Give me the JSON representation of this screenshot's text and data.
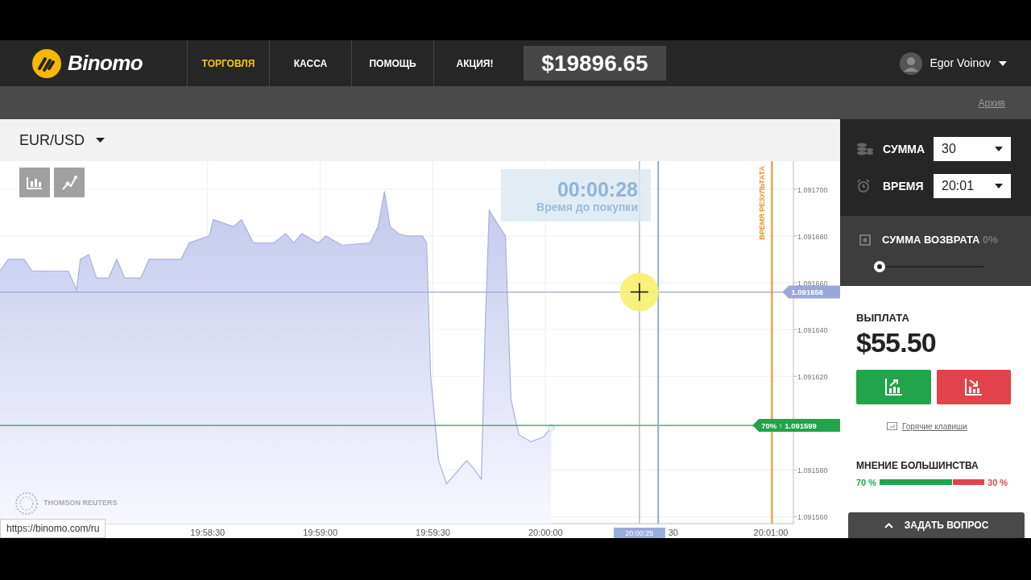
{
  "header": {
    "logo": "Binomo",
    "nav": [
      {
        "label": "ТОРГОВЛЯ",
        "selected": true
      },
      {
        "label": "КАССА",
        "selected": false
      },
      {
        "label": "ПОМОЩЬ",
        "selected": false
      },
      {
        "label": "АКЦИЯ!",
        "selected": false
      }
    ],
    "balance": "$19896.65",
    "user": {
      "name": "Egor Voinov"
    }
  },
  "subbar": {
    "archive_link": "Архив"
  },
  "chart_panel": {
    "pair": "EUR/USD",
    "timer": {
      "time": "00:00:28",
      "label": "Время до покупки"
    },
    "source": "THOMSON REUTERS",
    "clipped_time_label": "30",
    "crosshair_time": "20:00:25",
    "chart_data": {
      "type": "area",
      "grid": true,
      "xlim": [
        71854.7,
        72066
      ],
      "ylim": [
        1.091557,
        1.091712
      ],
      "xticks": [
        {
          "value": 71910,
          "label": "19:58:30"
        },
        {
          "value": 71940,
          "label": "19:59:00"
        },
        {
          "value": 71970,
          "label": "19:59:30"
        },
        {
          "value": 72000,
          "label": "20:00:00"
        },
        {
          "value": 72060,
          "label": "20:01:00"
        }
      ],
      "yticks": [
        {
          "value": 1.0917,
          "label": "1.091700"
        },
        {
          "value": 1.09168,
          "label": "1.091680"
        },
        {
          "value": 1.09166,
          "label": "1.091660"
        },
        {
          "value": 1.09164,
          "label": "1.091640"
        },
        {
          "value": 1.09162,
          "label": "1.091620"
        },
        {
          "value": 1.09158,
          "label": "1.091580"
        },
        {
          "value": 1.09156,
          "label": "1.091560"
        }
      ],
      "x": [
        71854.7,
        71856.9,
        71861.1,
        71863.3,
        71872.9,
        71875.1,
        71876.1,
        71878.3,
        71880.4,
        71883.6,
        71885.8,
        71887.9,
        71892.2,
        71894.4,
        71902.9,
        71905.1,
        71910.4,
        71911.5,
        71916.9,
        71919,
        71922.2,
        71927.6,
        71930.8,
        71932.9,
        71935.1,
        71939.4,
        71941.5,
        71945.8,
        71953.3,
        71955.4,
        71957.1,
        71958.6,
        71960.8,
        71962.9,
        71967.2,
        71968.3,
        71969.4,
        71971.5,
        71973.6,
        71975.8,
        71979,
        71981.1,
        71982.9,
        71983.9,
        71985,
        71986.5,
        71989.3,
        71990.8,
        71992.9,
        71996.1,
        71999.4,
        72001.5
      ],
      "series": [
        {
          "color": "#a9b0dd",
          "values": [
            1.091665,
            1.09167,
            1.09167,
            1.091665,
            1.091665,
            1.091657,
            1.09167,
            1.091672,
            1.091662,
            1.091662,
            1.09167,
            1.091662,
            1.091662,
            1.09167,
            1.09167,
            1.091677,
            1.09168,
            1.091687,
            1.091684,
            1.091687,
            1.091677,
            1.091677,
            1.091681,
            1.091677,
            1.091681,
            1.091677,
            1.09168,
            1.091676,
            1.091677,
            1.091684,
            1.091699,
            1.091684,
            1.091681,
            1.09168,
            1.09168,
            1.091677,
            1.09162,
            1.091584,
            1.091574,
            1.091578,
            1.091584,
            1.09158,
            1.091576,
            1.09164,
            1.091691,
            1.091687,
            1.09168,
            1.09161,
            1.091595,
            1.091592,
            1.091594,
            1.091598
          ]
        }
      ],
      "ref_lines": [
        {
          "axis": "y",
          "value": 1.091656,
          "label": "1.091656",
          "color": "#9aa7d9"
        },
        {
          "axis": "y",
          "value": 1.091599,
          "label": "70% ↑ 1.091599",
          "color": "#22a44b"
        },
        {
          "axis": "x",
          "value": 72025,
          "color": "#999999"
        },
        {
          "axis": "x",
          "value": 72030,
          "color": "#8ab0d6"
        },
        {
          "axis": "x",
          "value": 72060.3,
          "label": "ВРЕМЯ РЕЗУЛЬТАТА",
          "color": "#f0932b"
        }
      ]
    }
  },
  "trade_panel": {
    "amount": {
      "label": "СУММА",
      "value": "30"
    },
    "time": {
      "label": "ВРЕМЯ",
      "value": "20:01"
    },
    "refund": {
      "label": "СУММА ВОЗВРАТА",
      "percent": "0%",
      "level": 0
    },
    "payout": {
      "label": "ВЫПЛАТА",
      "value": "$55.50"
    },
    "hotkeys": "Горячие клавиши",
    "majority": {
      "label": "МНЕНИЕ БОЛЬШИНСТВА",
      "up": "70 %",
      "down": "30 %",
      "level": 0.7
    },
    "ask_button": "ЗАДАТЬ ВОПРОС"
  },
  "status_url": "https://binomo.com/ru"
}
